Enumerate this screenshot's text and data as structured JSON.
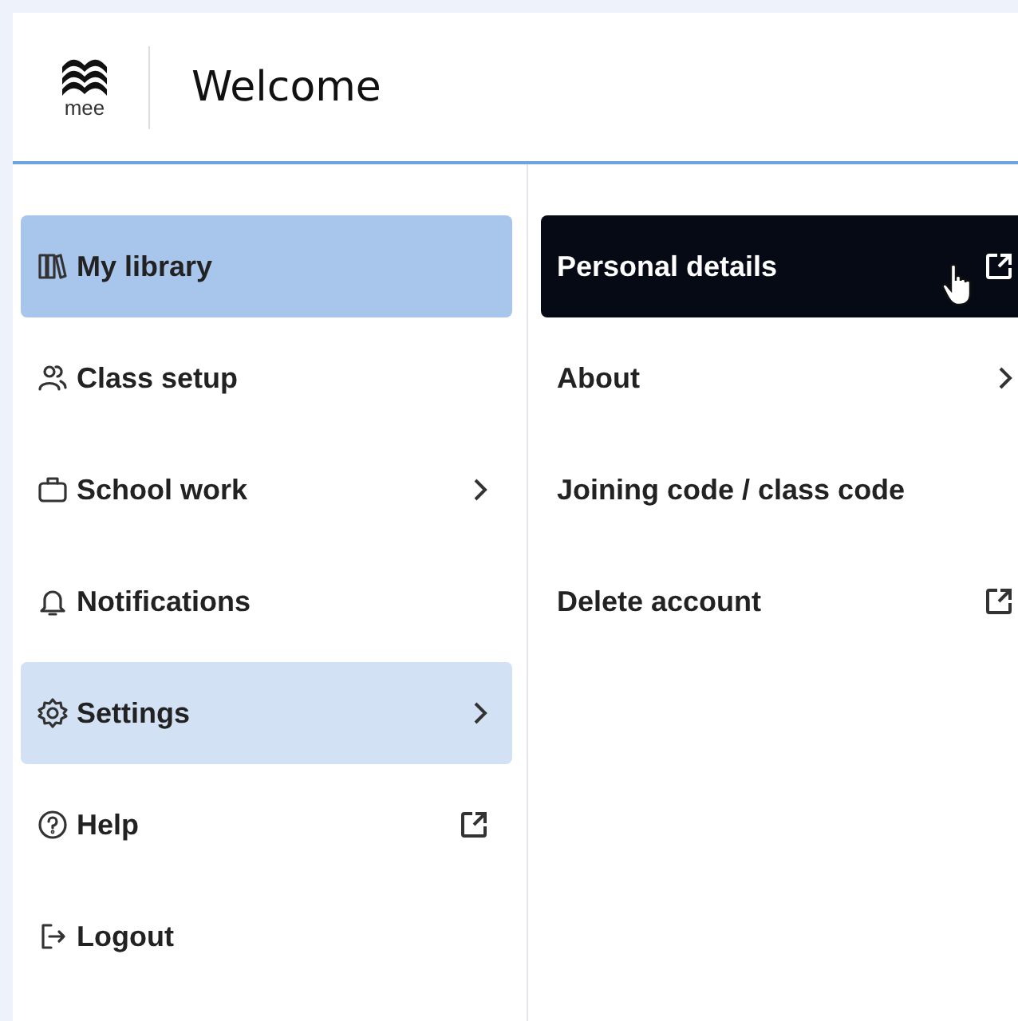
{
  "header": {
    "logo_text": "mee",
    "title": "Welcome"
  },
  "menu": [
    {
      "label": "My library",
      "kind": "books",
      "has_submenu": false,
      "external": false,
      "selected": true,
      "expanded": false
    },
    {
      "label": "Class setup",
      "kind": "people",
      "has_submenu": false,
      "external": false,
      "selected": false,
      "expanded": false
    },
    {
      "label": "School work",
      "kind": "briefcase",
      "has_submenu": true,
      "external": false,
      "selected": false,
      "expanded": false
    },
    {
      "label": "Notifications",
      "kind": "bell",
      "has_submenu": false,
      "external": false,
      "selected": false,
      "expanded": false
    },
    {
      "label": "Settings",
      "kind": "gear",
      "has_submenu": true,
      "external": false,
      "selected": false,
      "expanded": true
    },
    {
      "label": "Help",
      "kind": "help",
      "has_submenu": false,
      "external": true,
      "selected": false,
      "expanded": false
    },
    {
      "label": "Logout",
      "kind": "logout",
      "has_submenu": false,
      "external": false,
      "selected": false,
      "expanded": false
    }
  ],
  "submenu": [
    {
      "label": "Personal details",
      "has_submenu": false,
      "external": true,
      "hovered": true
    },
    {
      "label": "About",
      "has_submenu": true,
      "external": false,
      "hovered": false
    },
    {
      "label": "Joining code / class code",
      "has_submenu": false,
      "external": false,
      "hovered": false
    },
    {
      "label": "Delete account",
      "has_submenu": false,
      "external": true,
      "hovered": false
    }
  ]
}
